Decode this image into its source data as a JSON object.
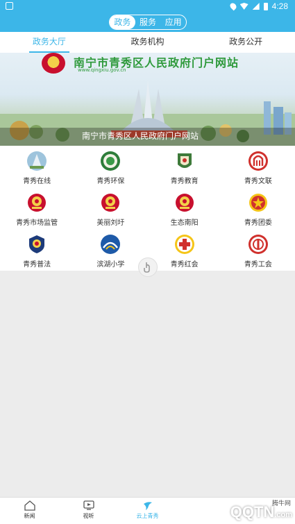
{
  "status": {
    "time": "4:28"
  },
  "header": {
    "segments": [
      {
        "label": "政务",
        "active": true
      },
      {
        "label": "服务",
        "active": false
      },
      {
        "label": "应用",
        "active": false
      }
    ]
  },
  "tabs": [
    {
      "label": "政务大厅",
      "active": true
    },
    {
      "label": "政务机构",
      "active": false
    },
    {
      "label": "政务公开",
      "active": false
    }
  ],
  "banner": {
    "title": "南宁市青秀区人民政府门户网站",
    "url": "www.qingxiu.gov.cn",
    "caption": "南宁市青秀区人民政府门户网站"
  },
  "services": [
    {
      "label": "青秀在线",
      "icon": "tower-icon"
    },
    {
      "label": "青秀环保",
      "icon": "env-protection-icon"
    },
    {
      "label": "青秀教育",
      "icon": "education-icon"
    },
    {
      "label": "青秀文联",
      "icon": "culture-federation-icon"
    },
    {
      "label": "青秀市场监管",
      "icon": "national-emblem-icon"
    },
    {
      "label": "美丽刘圩",
      "icon": "national-emblem-icon"
    },
    {
      "label": "生态南阳",
      "icon": "national-emblem-icon"
    },
    {
      "label": "青秀团委",
      "icon": "youth-league-icon"
    },
    {
      "label": "青秀普法",
      "icon": "police-badge-icon"
    },
    {
      "label": "滨湖小学",
      "icon": "school-icon"
    },
    {
      "label": "青秀红会",
      "icon": "red-cross-icon"
    },
    {
      "label": "青秀工会",
      "icon": "trade-union-icon"
    }
  ],
  "bottom_nav": [
    {
      "label": "新闻",
      "icon": "home-icon",
      "active": false
    },
    {
      "label": "视听",
      "icon": "tv-icon",
      "active": false
    },
    {
      "label": "云上青秀",
      "icon": "bird-icon",
      "active": true
    },
    {
      "label": "",
      "icon": "blank",
      "active": false
    },
    {
      "label": "",
      "icon": "blank",
      "active": false
    }
  ],
  "watermark": {
    "text": "QQTN",
    "small": "腾牛网",
    "suffix": ".com"
  },
  "colors": {
    "accent": "#3cb6e8",
    "emblem_red": "#c8102e",
    "gold": "#f3d04a"
  }
}
